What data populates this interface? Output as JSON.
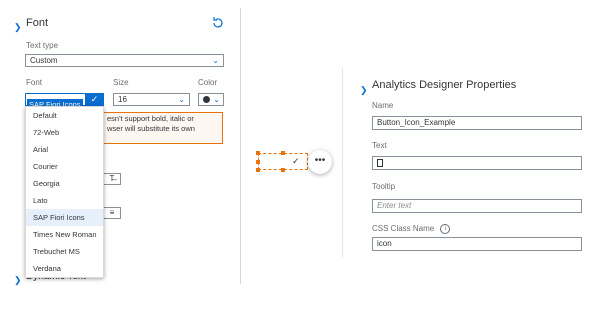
{
  "left_panel": {
    "section_title": "Font",
    "reset_icon": "reset-icon",
    "text_type": {
      "label": "Text type",
      "value": "Custom"
    },
    "font": {
      "label": "Font",
      "value": "SAP Fiori Icons"
    },
    "size": {
      "label": "Size",
      "value": "16"
    },
    "color": {
      "label": "Color",
      "value": "#32363a"
    },
    "warning_text_line1": "esn't support bold, italic or",
    "warning_text_line2": "wser will substitute its own",
    "dropdown_options": [
      "Default",
      "72-Web",
      "Arial",
      "Courier",
      "Georgia",
      "Lato",
      "SAP Fiori Icons",
      "Times New Roman",
      "Trebuchet MS",
      "Verdana"
    ],
    "selected_option": "SAP Fiori Icons",
    "dynamic_text_title": "Dynamic Text"
  },
  "canvas": {
    "button_icon": "checkmark-icon",
    "more_icon": "more-icon"
  },
  "right_panel": {
    "section_title": "Analytics Designer Properties",
    "name": {
      "label": "Name",
      "value": "Button_Icon_Example"
    },
    "text": {
      "label": "Text",
      "value": ""
    },
    "tooltip": {
      "label": "Tooltip",
      "placeholder": "Enter text"
    },
    "css_class": {
      "label": "CSS Class Name",
      "value": "icon"
    }
  }
}
